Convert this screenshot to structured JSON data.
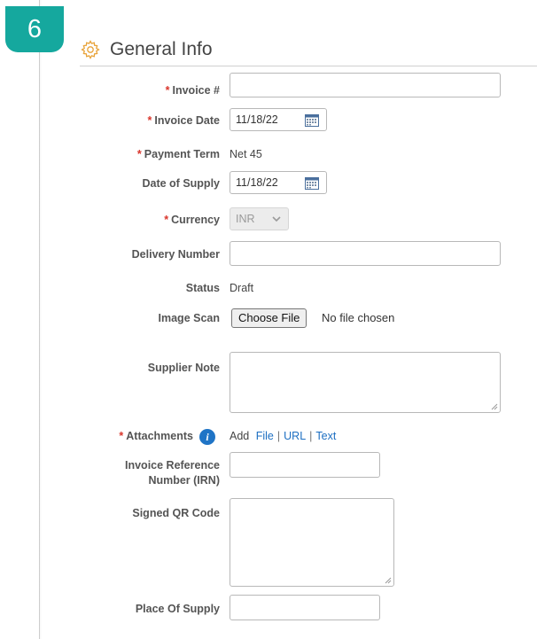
{
  "step": "6",
  "section": {
    "title": "General Info",
    "icon": "gear-icon"
  },
  "colors": {
    "required": "#d9352b",
    "link": "#1d6fc2",
    "badge": "#15a89e",
    "info": "#1f74c6"
  },
  "required_marker": "*",
  "fields": {
    "invoice_number": {
      "label": "Invoice #",
      "value": ""
    },
    "invoice_date": {
      "label": "Invoice Date",
      "value": "11/18/22"
    },
    "payment_term": {
      "label": "Payment Term",
      "value": "Net 45"
    },
    "date_of_supply": {
      "label": "Date of Supply",
      "value": "11/18/22"
    },
    "currency": {
      "label": "Currency",
      "value": "INR"
    },
    "delivery_number": {
      "label": "Delivery Number",
      "value": ""
    },
    "status": {
      "label": "Status",
      "value": "Draft"
    },
    "image_scan": {
      "label": "Image Scan",
      "button": "Choose File",
      "file_status": "No file chosen"
    },
    "supplier_note": {
      "label": "Supplier Note",
      "value": ""
    },
    "attachments": {
      "label": "Attachments",
      "info": "i",
      "add": "Add",
      "file": "File",
      "url": "URL",
      "text": "Text",
      "separator": "|"
    },
    "irn": {
      "label_line1": "Invoice Reference",
      "label_line2": "Number (IRN)",
      "value": ""
    },
    "signed_qr": {
      "label": "Signed QR Code",
      "value": ""
    },
    "place_of_supply": {
      "label": "Place Of Supply",
      "value": ""
    }
  }
}
